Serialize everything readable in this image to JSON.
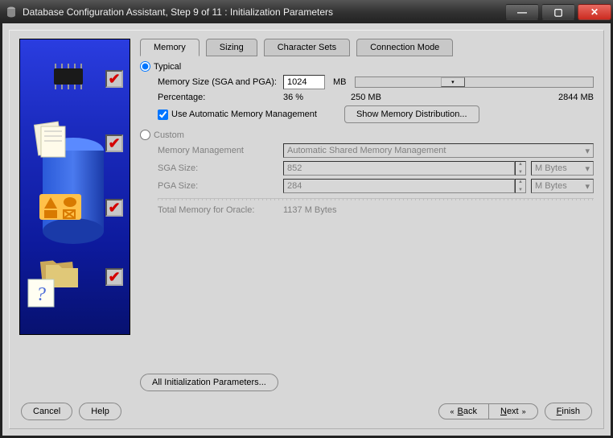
{
  "window": {
    "title": "Database Configuration Assistant, Step 9 of 11 : Initialization Parameters"
  },
  "tabs": {
    "memory": "Memory",
    "sizing": "Sizing",
    "character_sets": "Character Sets",
    "connection_mode": "Connection Mode",
    "active": "memory"
  },
  "memory": {
    "typical": {
      "label": "Typical",
      "selected": true,
      "mem_size_label": "Memory Size (SGA and PGA):",
      "mem_size_value": "1024",
      "mem_size_unit": "MB",
      "percentage_label": "Percentage:",
      "percentage_value": "36 %",
      "slider_min": "250 MB",
      "slider_max": "2844 MB",
      "use_amm_label": "Use Automatic Memory Management",
      "use_amm_checked": true,
      "show_dist_label": "Show Memory Distribution..."
    },
    "custom": {
      "label": "Custom",
      "selected": false,
      "mem_mgmt_label": "Memory Management",
      "mem_mgmt_value": "Automatic Shared Memory Management",
      "sga_label": "SGA Size:",
      "sga_value": "852",
      "pga_label": "PGA Size:",
      "pga_value": "284",
      "unit": "M Bytes",
      "total_label": "Total Memory for Oracle:",
      "total_value": "1137 M Bytes"
    }
  },
  "all_params_button": "All Initialization Parameters...",
  "footer": {
    "cancel": "Cancel",
    "help": "Help",
    "back": "Back",
    "next": "Next",
    "finish": "Finish"
  }
}
